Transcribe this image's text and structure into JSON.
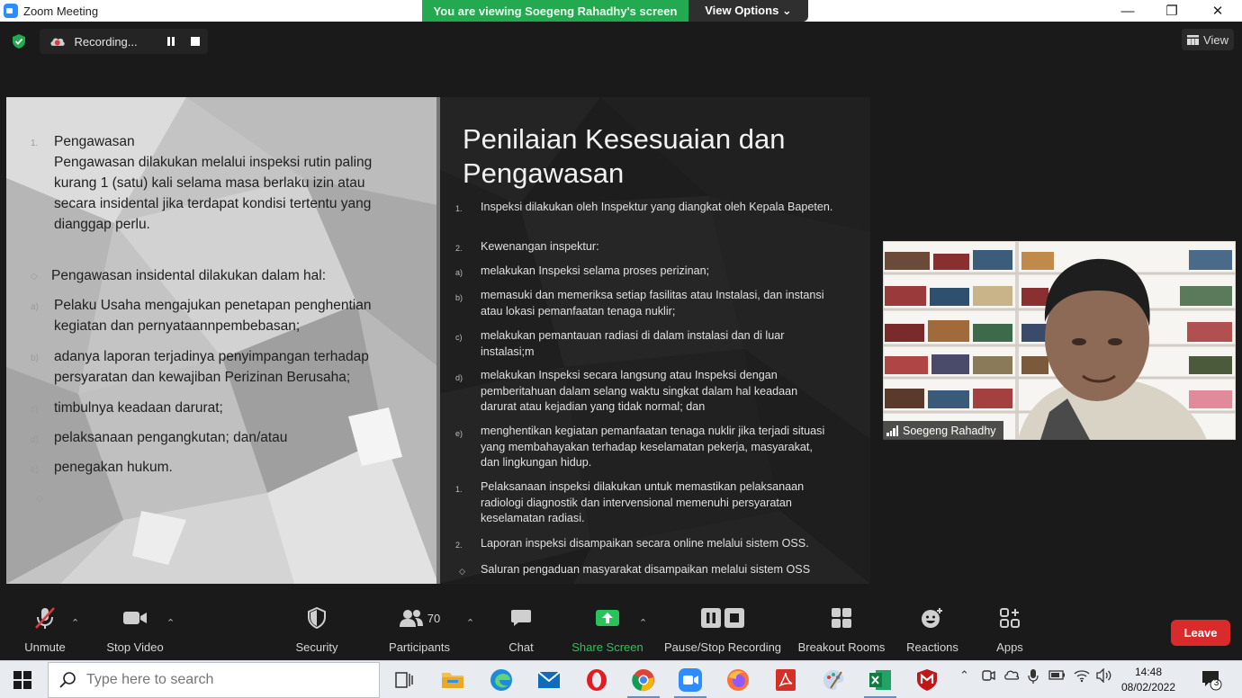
{
  "window": {
    "title": "Zoom Meeting",
    "minimize": "—",
    "restore": "❐",
    "close": "✕"
  },
  "banner": {
    "viewing": "You are viewing Soegeng Rahadhy's screen",
    "view_options": "View Options ⌄"
  },
  "recording": {
    "status": "Recording..."
  },
  "view_button": {
    "label": "View"
  },
  "slide_left": {
    "items": [
      {
        "marker": "1.",
        "text": "Pengawasan"
      },
      {
        "marker": "",
        "text": "Pengawasan dilakukan melalui inspeksi rutin paling kurang 1 (satu) kali selama masa berlaku izin atau secara insidental jika terdapat kondisi tertentu yang dianggap perlu."
      },
      {
        "marker": "◇",
        "text": "Pengawasan insidental dilakukan dalam hal:"
      },
      {
        "marker": "a)",
        "text": "Pelaku Usaha mengajukan penetapan penghentian kegiatan dan pernyataannpembebasan;"
      },
      {
        "marker": "b)",
        "text": "adanya laporan terjadinya penyimpangan terhadap persyaratan dan kewajiban Perizinan Berusaha;"
      },
      {
        "marker": "c)",
        "text": "timbulnya keadaan darurat;"
      },
      {
        "marker": "d)",
        "text": "pelaksanaan pengangkutan; dan/atau"
      },
      {
        "marker": "e)",
        "text": "penegakan hukum."
      },
      {
        "marker": "◇",
        "text": ""
      }
    ]
  },
  "slide_right": {
    "title": "Penilaian Kesesuaian dan Pengawasan",
    "items": [
      {
        "marker": "1.",
        "text": "Inspeksi dilakukan oleh Inspektur yang diangkat oleh Kepala Bapeten."
      },
      {
        "marker": "2.",
        "text": "Kewenangan inspektur:"
      },
      {
        "marker": "a)",
        "text": "melakukan Inspeksi selama proses perizinan;"
      },
      {
        "marker": "b)",
        "text": "memasuki dan memeriksa setiap fasilitas atau Instalasi, dan instansi atau lokasi pemanfaatan tenaga nuklir;"
      },
      {
        "marker": "c)",
        "text": "melakukan pemantauan radiasi di dalam instalasi dan di luar instalasi;m"
      },
      {
        "marker": "d)",
        "text": "melakukan Inspeksi secara langsung atau Inspeksi dengan pemberitahuan dalam selang waktu singkat dalam hal keadaan darurat atau kejadian yang tidak normal; dan"
      },
      {
        "marker": "e)",
        "text": "menghentikan kegiatan pemanfaatan tenaga nuklir jika terjadi situasi yang membahayakan terhadap keselamatan pekerja, masyarakat, dan lingkungan hidup."
      },
      {
        "marker": "1.",
        "text": "Pelaksanaan inspeksi dilakukan untuk memastikan pelaksanaan radiologi diagnostik dan intervensional memenuhi persyaratan keselamatan radiasi."
      },
      {
        "marker": "2.",
        "text": "Laporan inspeksi disampaikan secara online melalui sistem OSS."
      },
      {
        "marker": "◇",
        "text": "Saluran pengaduan masyarakat disampaikan melalui sistem OSS"
      }
    ]
  },
  "participant": {
    "name": "Soegeng Rahadhy"
  },
  "toolbar": {
    "unmute": "Unmute",
    "stop_video": "Stop Video",
    "security": "Security",
    "participants": "Participants",
    "participants_count": "70",
    "chat": "Chat",
    "share_screen": "Share Screen",
    "pause_stop_recording": "Pause/Stop Recording",
    "breakout_rooms": "Breakout Rooms",
    "reactions": "Reactions",
    "apps": "Apps",
    "leave": "Leave"
  },
  "taskbar": {
    "search_placeholder": "Type here to search",
    "time": "14:48",
    "date": "08/02/2022",
    "notification_count": "3"
  },
  "colors": {
    "banner_green": "#23a94f",
    "share_green": "#28c35a",
    "leave_red": "#d92b2b",
    "toolbar_bg": "#1a1a1a"
  }
}
